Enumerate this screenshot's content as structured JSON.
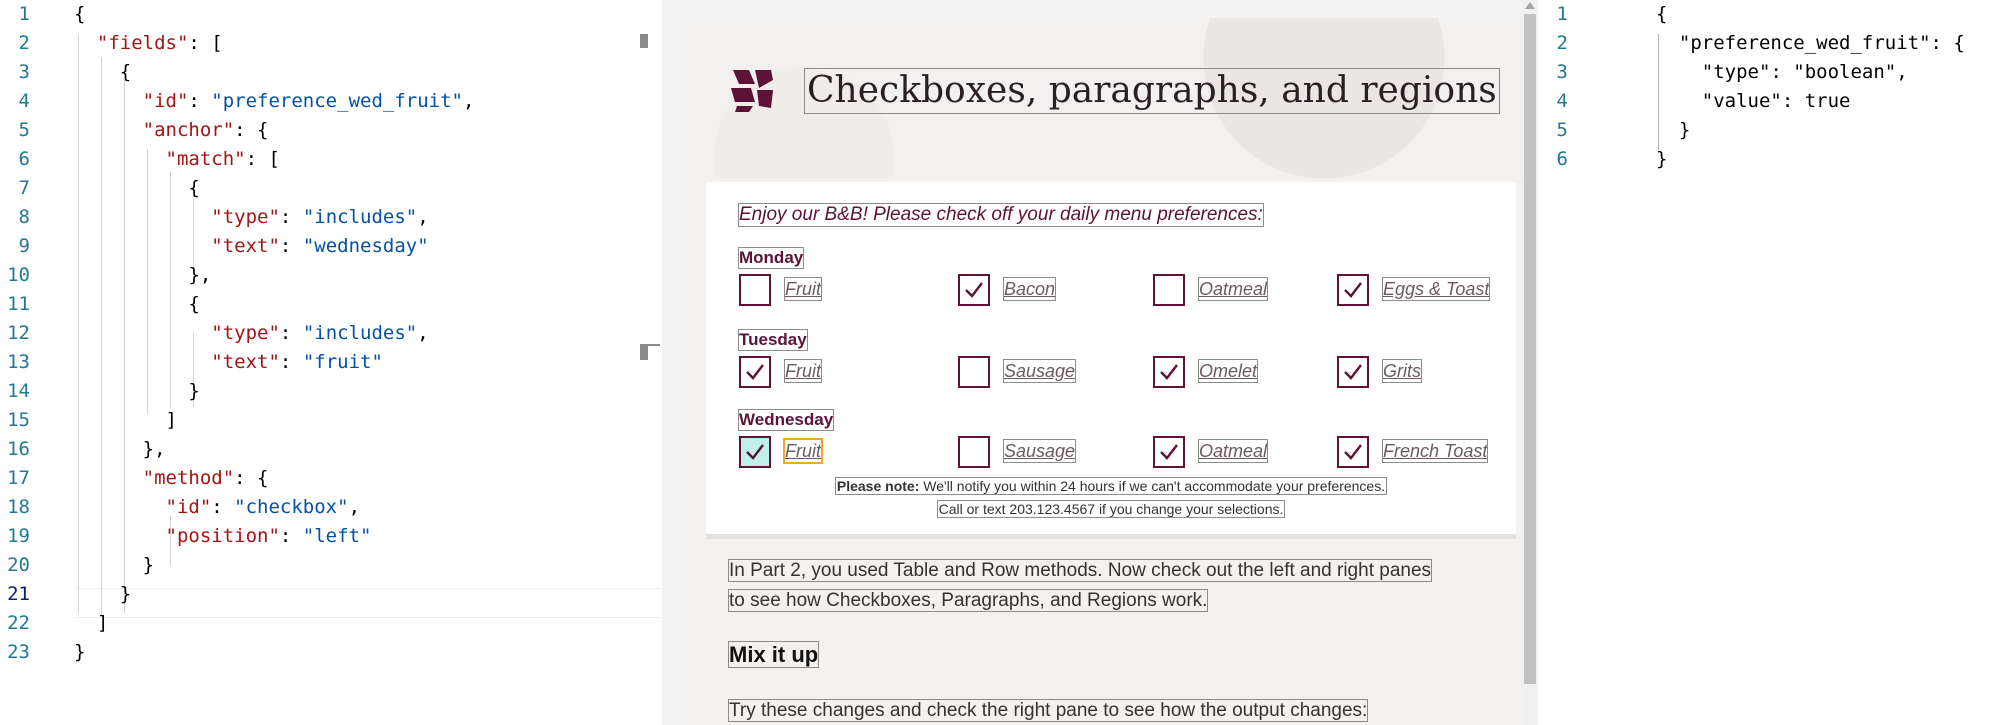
{
  "left_editor": {
    "lines": [
      {
        "n": "1",
        "tokens": [
          {
            "t": "p",
            "v": "{"
          }
        ]
      },
      {
        "n": "2",
        "tokens": [
          {
            "t": "p",
            "v": "  "
          },
          {
            "t": "k",
            "v": "\"fields\""
          },
          {
            "t": "p",
            "v": ": ["
          }
        ]
      },
      {
        "n": "3",
        "tokens": [
          {
            "t": "p",
            "v": "    {"
          }
        ]
      },
      {
        "n": "4",
        "tokens": [
          {
            "t": "p",
            "v": "      "
          },
          {
            "t": "k",
            "v": "\"id\""
          },
          {
            "t": "p",
            "v": ": "
          },
          {
            "t": "s",
            "v": "\"preference_wed_fruit\""
          },
          {
            "t": "p",
            "v": ","
          }
        ]
      },
      {
        "n": "5",
        "tokens": [
          {
            "t": "p",
            "v": "      "
          },
          {
            "t": "k",
            "v": "\"anchor\""
          },
          {
            "t": "p",
            "v": ": {"
          }
        ]
      },
      {
        "n": "6",
        "tokens": [
          {
            "t": "p",
            "v": "        "
          },
          {
            "t": "k",
            "v": "\"match\""
          },
          {
            "t": "p",
            "v": ": ["
          }
        ]
      },
      {
        "n": "7",
        "tokens": [
          {
            "t": "p",
            "v": "          {"
          }
        ]
      },
      {
        "n": "8",
        "tokens": [
          {
            "t": "p",
            "v": "            "
          },
          {
            "t": "k",
            "v": "\"type\""
          },
          {
            "t": "p",
            "v": ": "
          },
          {
            "t": "s",
            "v": "\"includes\""
          },
          {
            "t": "p",
            "v": ","
          }
        ]
      },
      {
        "n": "9",
        "tokens": [
          {
            "t": "p",
            "v": "            "
          },
          {
            "t": "k",
            "v": "\"text\""
          },
          {
            "t": "p",
            "v": ": "
          },
          {
            "t": "s",
            "v": "\"wednesday\""
          }
        ]
      },
      {
        "n": "10",
        "tokens": [
          {
            "t": "p",
            "v": "          },"
          }
        ]
      },
      {
        "n": "11",
        "tokens": [
          {
            "t": "p",
            "v": "          {"
          }
        ]
      },
      {
        "n": "12",
        "tokens": [
          {
            "t": "p",
            "v": "            "
          },
          {
            "t": "k",
            "v": "\"type\""
          },
          {
            "t": "p",
            "v": ": "
          },
          {
            "t": "s",
            "v": "\"includes\""
          },
          {
            "t": "p",
            "v": ","
          }
        ]
      },
      {
        "n": "13",
        "tokens": [
          {
            "t": "p",
            "v": "            "
          },
          {
            "t": "k",
            "v": "\"text\""
          },
          {
            "t": "p",
            "v": ": "
          },
          {
            "t": "s",
            "v": "\"fruit\""
          }
        ]
      },
      {
        "n": "14",
        "tokens": [
          {
            "t": "p",
            "v": "          }"
          }
        ]
      },
      {
        "n": "15",
        "tokens": [
          {
            "t": "p",
            "v": "        ]"
          }
        ]
      },
      {
        "n": "16",
        "tokens": [
          {
            "t": "p",
            "v": "      },"
          }
        ]
      },
      {
        "n": "17",
        "tokens": [
          {
            "t": "p",
            "v": "      "
          },
          {
            "t": "k",
            "v": "\"method\""
          },
          {
            "t": "p",
            "v": ": {"
          }
        ]
      },
      {
        "n": "18",
        "tokens": [
          {
            "t": "p",
            "v": "        "
          },
          {
            "t": "k",
            "v": "\"id\""
          },
          {
            "t": "p",
            "v": ": "
          },
          {
            "t": "s",
            "v": "\"checkbox\""
          },
          {
            "t": "p",
            "v": ","
          }
        ]
      },
      {
        "n": "19",
        "tokens": [
          {
            "t": "p",
            "v": "        "
          },
          {
            "t": "k",
            "v": "\"position\""
          },
          {
            "t": "p",
            "v": ": "
          },
          {
            "t": "s",
            "v": "\"left\""
          }
        ]
      },
      {
        "n": "20",
        "tokens": [
          {
            "t": "p",
            "v": "      }"
          }
        ]
      },
      {
        "n": "21",
        "tokens": [
          {
            "t": "p",
            "v": "    }"
          }
        ]
      },
      {
        "n": "22",
        "tokens": [
          {
            "t": "p",
            "v": "  ]"
          }
        ]
      },
      {
        "n": "23",
        "tokens": [
          {
            "t": "p",
            "v": "}"
          }
        ]
      }
    ],
    "active_line": "21"
  },
  "right_editor": {
    "lines": [
      {
        "n": "1",
        "tokens": [
          {
            "t": "p",
            "v": "{"
          }
        ]
      },
      {
        "n": "2",
        "tokens": [
          {
            "t": "p",
            "v": "  \"preference_wed_fruit\": {"
          }
        ]
      },
      {
        "n": "3",
        "tokens": [
          {
            "t": "p",
            "v": "    \"type\": \"boolean\","
          }
        ]
      },
      {
        "n": "4",
        "tokens": [
          {
            "t": "p",
            "v": "    \"value\": true"
          }
        ]
      },
      {
        "n": "5",
        "tokens": [
          {
            "t": "p",
            "v": "  }"
          }
        ]
      },
      {
        "n": "6",
        "tokens": [
          {
            "t": "p",
            "v": "}"
          }
        ]
      }
    ]
  },
  "preview": {
    "title": "Checkboxes, paragraphs, and regions",
    "intro": "Enjoy our B&B! Please check off your daily menu preferences:",
    "days": [
      {
        "name": "Monday",
        "options": [
          {
            "label": "Fruit",
            "checked": false
          },
          {
            "label": "Bacon",
            "checked": true
          },
          {
            "label": "Oatmeal",
            "checked": false
          },
          {
            "label": "Eggs & Toast",
            "checked": true
          }
        ]
      },
      {
        "name": "Tuesday",
        "options": [
          {
            "label": "Fruit",
            "checked": true
          },
          {
            "label": "Sausage",
            "checked": false
          },
          {
            "label": "Omelet",
            "checked": true
          },
          {
            "label": "Grits",
            "checked": true
          }
        ]
      },
      {
        "name": "Wednesday",
        "options": [
          {
            "label": "Fruit",
            "checked": true,
            "highlighted": true
          },
          {
            "label": "Sausage",
            "checked": false
          },
          {
            "label": "Oatmeal",
            "checked": true
          },
          {
            "label": "French Toast",
            "checked": true
          }
        ]
      }
    ],
    "note_bold": "Please note:",
    "note_rest": " We'll notify you within 24 hours if we can't accommodate your preferences.",
    "note_line2": "Call or text 203.123.4567 if you change your selections.",
    "paragraph_line1": "In Part 2, you used Table and Row methods. Now check out the left and right panes",
    "paragraph_line2": "to see how Checkboxes, Paragraphs, and Regions work.",
    "heading": "Mix it up",
    "paragraph2": "Try these changes and check the right pane to see how the output changes:"
  },
  "colors": {
    "accent": "#5c1337",
    "string": "#0451a5",
    "key": "#a31515",
    "line_number": "#237893",
    "highlight_box": "#f5a623"
  }
}
